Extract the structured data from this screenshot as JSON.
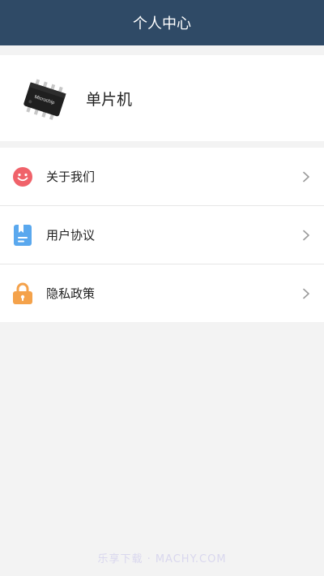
{
  "header": {
    "title": "个人中心"
  },
  "profile": {
    "name": "单片机",
    "chip_text": "Microchip"
  },
  "menu": {
    "items": [
      {
        "label": "关于我们",
        "icon": "smiley-icon",
        "icon_color": "#f0626a"
      },
      {
        "label": "用户协议",
        "icon": "document-bookmark-icon",
        "icon_color": "#5aa8ee"
      },
      {
        "label": "隐私政策",
        "icon": "lock-icon",
        "icon_color": "#f4a24b"
      }
    ]
  },
  "watermark": {
    "text": "乐享下载 · MACHY.COM"
  },
  "colors": {
    "header_bg": "#2f4a66",
    "page_bg": "#f3f3f3",
    "card_bg": "#ffffff",
    "chevron": "#9a9a9a"
  }
}
